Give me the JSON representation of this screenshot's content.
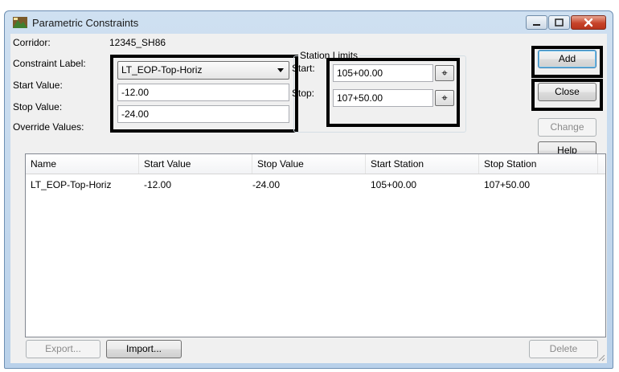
{
  "window": {
    "title": "Parametric Constraints",
    "icon": "corridor-app-icon"
  },
  "form": {
    "corridor_label": "Corridor:",
    "corridor_value": "12345_SH86",
    "constraint_label": "Constraint Label:",
    "constraint_value": "LT_EOP-Top-Horiz",
    "start_value_label": "Start Value:",
    "start_value": "-12.00",
    "stop_value_label": "Stop Value:",
    "stop_value": "-24.00",
    "override_label": "Override Values:"
  },
  "station_limits": {
    "title": "Station Limits",
    "start_label": "Start:",
    "start_value": "105+00.00",
    "stop_label": "Stop:",
    "stop_value": "107+50.00"
  },
  "buttons": {
    "add": "Add",
    "close": "Close",
    "change": "Change",
    "help": "Help",
    "export": "Export...",
    "import": "Import...",
    "delete": "Delete"
  },
  "table": {
    "columns": [
      "Name",
      "Start Value",
      "Stop Value",
      "Start Station",
      "Stop Station"
    ],
    "rows": [
      [
        "LT_EOP-Top-Horiz",
        "-12.00",
        "-24.00",
        "105+00.00",
        "107+50.00"
      ]
    ]
  },
  "colors": {
    "highlight_box": "#000000",
    "close_button": "#c7442a"
  }
}
